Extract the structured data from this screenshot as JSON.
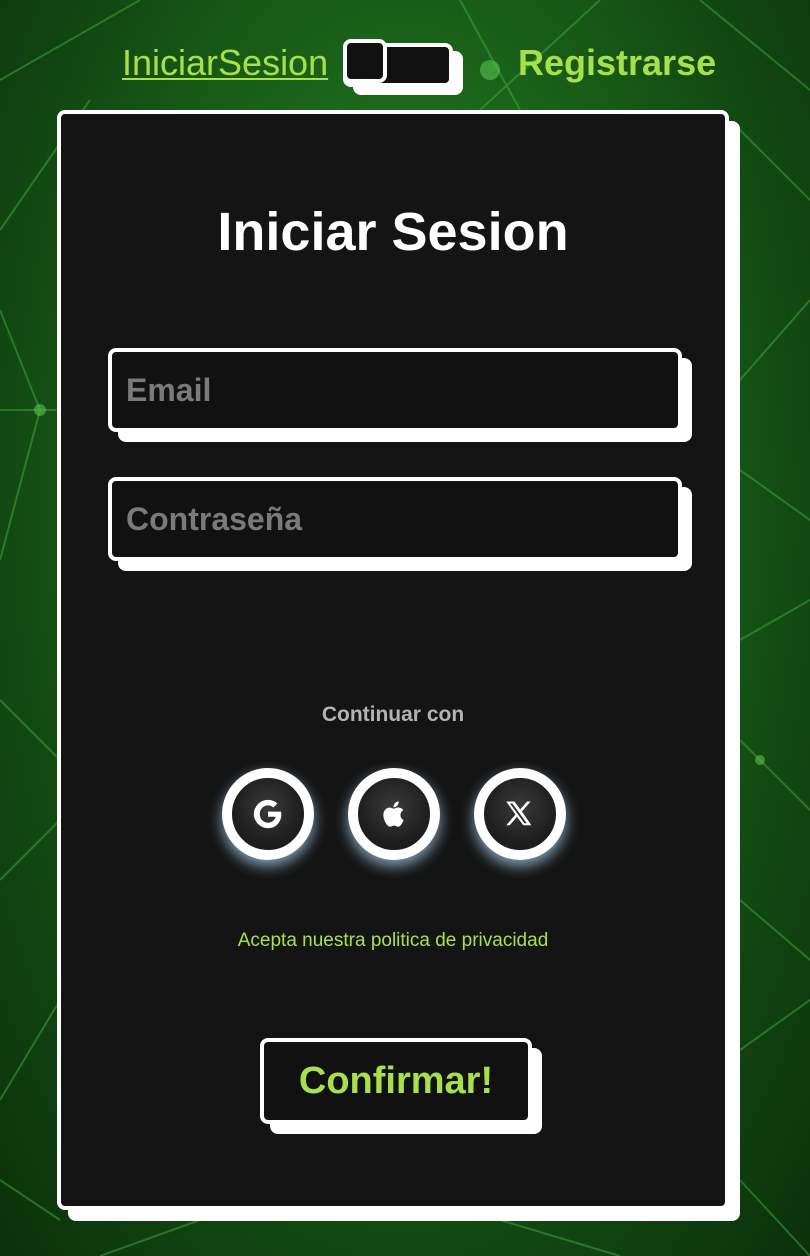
{
  "colors": {
    "accent_green": "#a8e04a",
    "card_background": "#141414",
    "border_white": "#ffffff",
    "background_green": "#1d6a1c"
  },
  "top_toggle": {
    "login_label": "IniciarSesion",
    "register_label": "Registrarse",
    "switch_state": "off"
  },
  "form": {
    "title": "Iniciar Sesion",
    "email": {
      "placeholder": "Email",
      "value": ""
    },
    "password": {
      "placeholder": "Contraseña",
      "value": ""
    },
    "continue_label": "Continuar con",
    "social_buttons": [
      {
        "icon": "google-icon"
      },
      {
        "icon": "apple-icon"
      },
      {
        "icon": "x-icon"
      }
    ],
    "privacy_link": "Acepta nuestra politica de privacidad",
    "confirm_label": "Confirmar!"
  }
}
